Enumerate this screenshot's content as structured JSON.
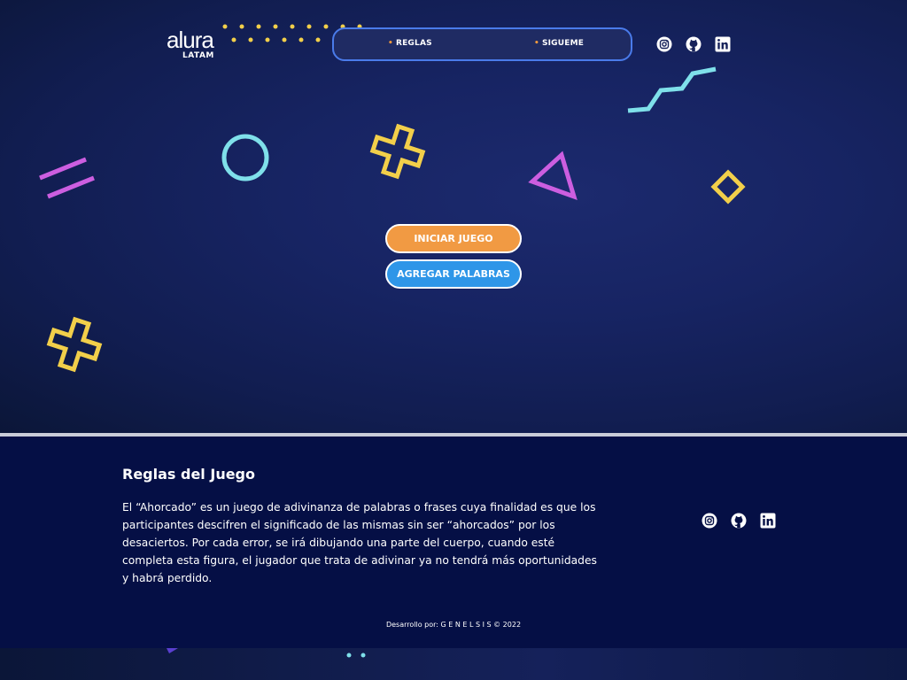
{
  "brand": {
    "name": "alura",
    "sub": "LATAM"
  },
  "nav": {
    "items": [
      {
        "label": "REGLAS"
      },
      {
        "label": "SIGUEME"
      }
    ]
  },
  "header_icons": [
    "instagram-icon",
    "github-icon",
    "linkedin-icon"
  ],
  "actions": {
    "start_label": "INICIAR JUEGO",
    "add_label": "AGREGAR PALABRAS"
  },
  "footer": {
    "title": "Reglas del Juego",
    "text": "El “Ahorcado” es un juego de adivinanza de palabras o frases cuya finalidad es que los participantes descifren el significado de las mismas sin ser “ahorcados” por los desaciertos. Por cada error, se irá dibujando una parte del cuerpo, cuando esté completa esta figura, el jugador que trata de adivinar ya no tendrá más oportunidades y habrá perdido.",
    "credit_prefix": "Desarrollo por:",
    "credit_name": "G E N E L S I S",
    "credit_suffix": "© 2022",
    "icons": [
      "instagram-icon",
      "github-icon",
      "linkedin-icon"
    ]
  },
  "colors": {
    "accent_orange": "#f19a43",
    "accent_blue": "#2e96e8",
    "nav_border": "#4a7bea",
    "shape_yellow": "#f2cf4a",
    "shape_cyan": "#7fe0ea",
    "shape_purple": "#cc5ee0",
    "footer_bg": "#050f45"
  }
}
